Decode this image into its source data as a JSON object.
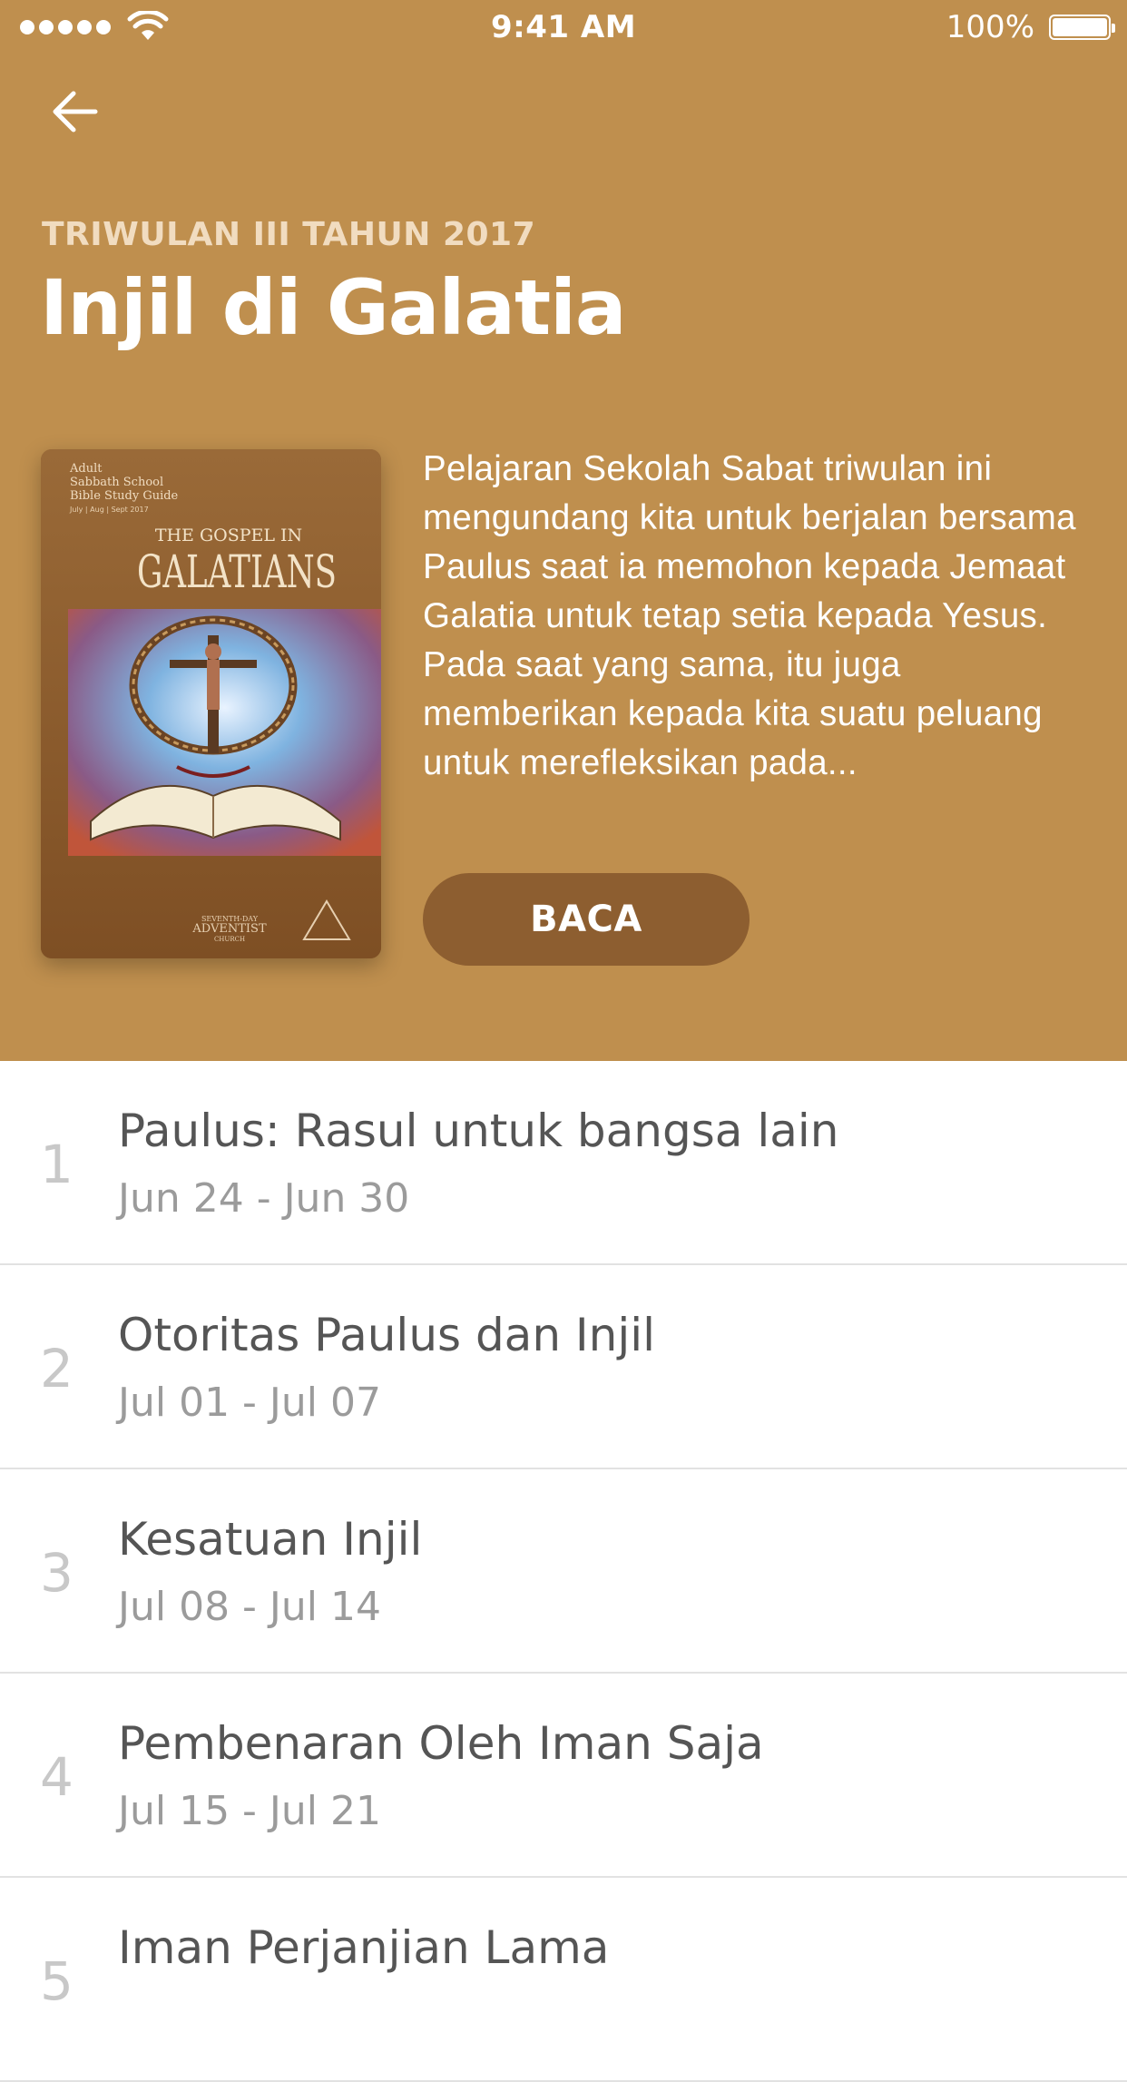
{
  "status_bar": {
    "time": "9:41 AM",
    "battery_percent": "100%",
    "signal_dots": 5,
    "icons": [
      "signal-icon",
      "wifi-icon",
      "battery-icon"
    ]
  },
  "header": {
    "back_icon": "arrow-left-icon",
    "quarter_label": "TRIWULAN III TAHUN 2017",
    "title": "Injil di Galatia",
    "background_color": "#bf8f4e",
    "cover": {
      "small_lines": [
        "Adult",
        "Sabbath School",
        "Bible Study Guide",
        "July | Aug | Sept 2017"
      ],
      "line1": "THE GOSPEL IN",
      "line2": "GALATIANS",
      "publisher_lines": [
        "SEVENTH-DAY",
        "ADVENTIST",
        "CHURCH"
      ]
    },
    "description": "Pelajaran Sekolah Sabat triwulan ini mengundang kita untuk berjalan bersama Paulus saat ia memohon kepada Jemaat Galatia untuk tetap setia kepada Yesus. Pada saat yang sama, itu juga memberikan kepada kita suatu peluang untuk merefleksikan pada...",
    "read_button": "BACA",
    "button_color": "#8d5e30"
  },
  "lessons": [
    {
      "number": "1",
      "title": "Paulus: Rasul untuk bangsa lain",
      "date": "Jun 24 - Jun 30"
    },
    {
      "number": "2",
      "title": "Otoritas Paulus dan Injil",
      "date": "Jul 01 - Jul 07"
    },
    {
      "number": "3",
      "title": "Kesatuan Injil",
      "date": "Jul 08 - Jul 14"
    },
    {
      "number": "4",
      "title": "Pembenaran Oleh Iman Saja",
      "date": "Jul 15 - Jul 21"
    },
    {
      "number": "5",
      "title": "Iman Perjanjian Lama",
      "date": ""
    }
  ]
}
